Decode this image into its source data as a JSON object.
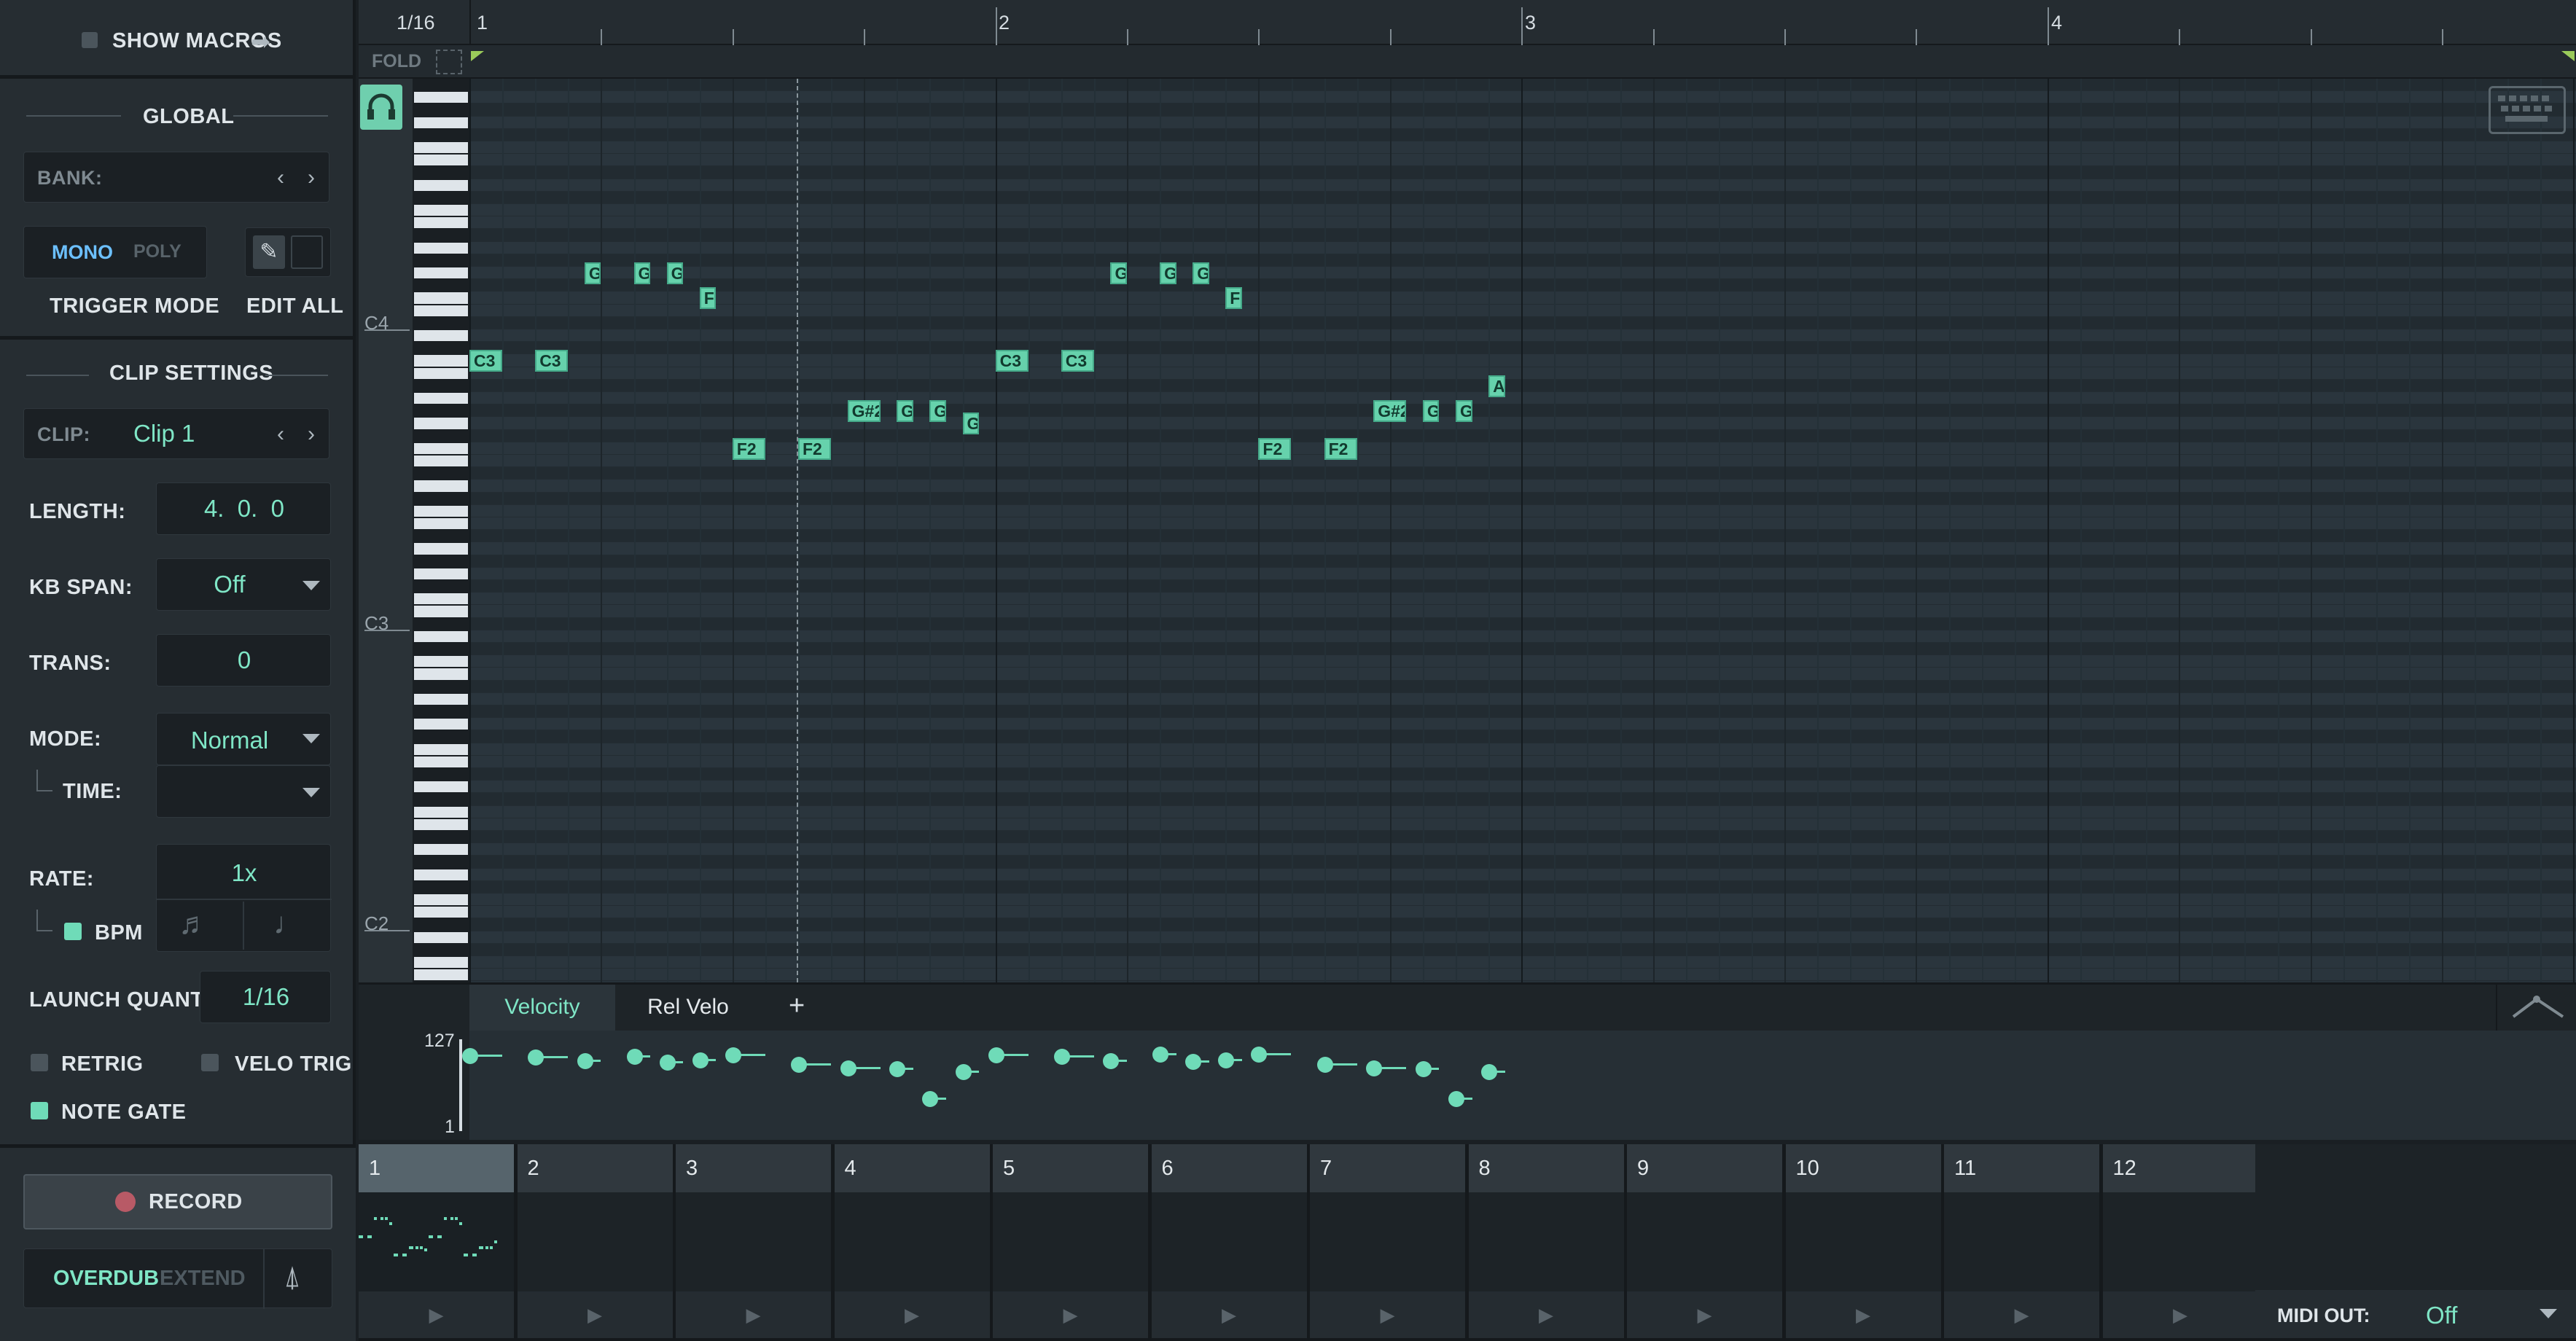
{
  "left": {
    "show_macros": "SHOW MACROS",
    "global": {
      "header": "GLOBAL",
      "bank_label": "BANK:",
      "mono": "MONO",
      "poly": "POLY",
      "trigger_mode": "TRIGGER MODE",
      "edit_all": "EDIT ALL"
    },
    "clip_settings": {
      "header": "CLIP SETTINGS",
      "clip_label": "CLIP:",
      "clip_value": "Clip 1",
      "length_label": "LENGTH:",
      "length_value": "4.  0.  0",
      "kb_span_label": "KB SPAN:",
      "kb_span_value": "Off",
      "trans_label": "TRANS:",
      "trans_value": "0",
      "mode_label": "MODE:",
      "mode_value": "Normal",
      "time_label": "TIME:",
      "rate_label": "RATE:",
      "rate_value": "1x",
      "bpm_label": "BPM",
      "launch_quant_label": "LAUNCH QUANT:",
      "launch_quant_value": "1/16",
      "retrig": "RETRIG",
      "velo_trig": "VELO TRIG",
      "note_gate": "NOTE GATE"
    },
    "record": {
      "record": "RECORD",
      "overdub": "OVERDUB",
      "extend": "EXTEND"
    }
  },
  "ruler": {
    "grid": "1/16",
    "bars": [
      "1",
      "2",
      "3",
      "4"
    ],
    "fold": "FOLD"
  },
  "keyboard": {
    "labels": [
      "C4",
      "C3",
      "C2"
    ]
  },
  "notes": [
    {
      "label": "C3",
      "start": 0.0,
      "len": 0.5,
      "pitch": 48
    },
    {
      "label": "C3",
      "start": 1.0,
      "len": 0.5,
      "pitch": 48
    },
    {
      "label": "G",
      "start": 1.75,
      "len": 0.25,
      "pitch": 55
    },
    {
      "label": "G",
      "start": 2.5,
      "len": 0.25,
      "pitch": 55
    },
    {
      "label": "G",
      "start": 3.0,
      "len": 0.25,
      "pitch": 55
    },
    {
      "label": "F",
      "start": 3.5,
      "len": 0.25,
      "pitch": 53
    },
    {
      "label": "F2",
      "start": 4.0,
      "len": 0.5,
      "pitch": 41
    },
    {
      "label": "F2",
      "start": 5.0,
      "len": 0.5,
      "pitch": 41
    },
    {
      "label": "G#2",
      "start": 5.75,
      "len": 0.5,
      "pitch": 44
    },
    {
      "label": "G#",
      "start": 6.5,
      "len": 0.25,
      "pitch": 44
    },
    {
      "label": "G#",
      "start": 7.0,
      "len": 0.25,
      "pitch": 44
    },
    {
      "label": "G",
      "start": 7.5,
      "len": 0.25,
      "pitch": 43
    },
    {
      "label": "C3",
      "start": 8.0,
      "len": 0.5,
      "pitch": 48
    },
    {
      "label": "C3",
      "start": 9.0,
      "len": 0.5,
      "pitch": 48
    },
    {
      "label": "G",
      "start": 9.75,
      "len": 0.25,
      "pitch": 55
    },
    {
      "label": "G",
      "start": 10.5,
      "len": 0.25,
      "pitch": 55
    },
    {
      "label": "G",
      "start": 11.0,
      "len": 0.25,
      "pitch": 55
    },
    {
      "label": "F",
      "start": 11.5,
      "len": 0.25,
      "pitch": 53
    },
    {
      "label": "F2",
      "start": 12.0,
      "len": 0.5,
      "pitch": 41
    },
    {
      "label": "F2",
      "start": 13.0,
      "len": 0.5,
      "pitch": 41
    },
    {
      "label": "G#2",
      "start": 13.75,
      "len": 0.5,
      "pitch": 44
    },
    {
      "label": "G#",
      "start": 14.5,
      "len": 0.25,
      "pitch": 44
    },
    {
      "label": "G#",
      "start": 15.0,
      "len": 0.25,
      "pitch": 44
    },
    {
      "label": "A#",
      "start": 15.5,
      "len": 0.25,
      "pitch": 46
    }
  ],
  "velocity": {
    "tabs": [
      "Velocity",
      "Rel Velo",
      "+"
    ],
    "max": "127",
    "min": "1",
    "values": [
      115,
      113,
      108,
      114,
      106,
      109,
      116,
      103,
      98,
      97,
      55,
      93,
      116,
      114,
      108,
      117,
      107,
      109,
      117,
      103,
      98,
      97,
      55,
      93
    ]
  },
  "clips": {
    "slots": [
      "1",
      "2",
      "3",
      "4",
      "5",
      "6",
      "7",
      "8",
      "9",
      "10",
      "11",
      "12"
    ],
    "midi_out_label": "MIDI OUT:",
    "midi_out_value": "Off"
  },
  "colors": {
    "accent": "#6fdbb8",
    "note": "#66d2ac",
    "background": "#27323a"
  },
  "icons": [
    "arrow-right-icon",
    "headphones-icon",
    "keyboard-icon",
    "pencil-icon",
    "chevron-left-icon",
    "chevron-right-icon",
    "record-icon",
    "play-icon",
    "curve-icon",
    "metronome-icon",
    "note-icon",
    "expand-icon"
  ]
}
